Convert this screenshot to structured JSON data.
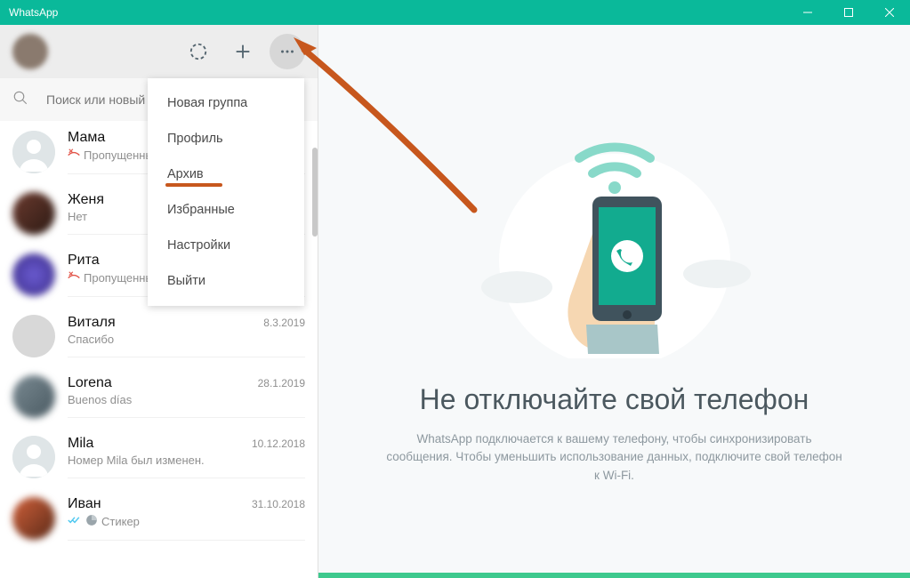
{
  "window": {
    "title": "WhatsApp"
  },
  "search": {
    "placeholder": "Поиск или новый чат"
  },
  "menu": {
    "items": [
      {
        "label": "Новая группа"
      },
      {
        "label": "Профиль"
      },
      {
        "label": "Архив",
        "highlight": true
      },
      {
        "label": "Избранные"
      },
      {
        "label": "Настройки"
      },
      {
        "label": "Выйти"
      }
    ]
  },
  "chats": [
    {
      "name": "Мама",
      "date": "",
      "preview": "Пропущенный звонок",
      "missed": true,
      "avatar": "person"
    },
    {
      "name": "Женя",
      "date": "",
      "preview": "Нет",
      "avatar": "blur1"
    },
    {
      "name": "Рита",
      "date": "",
      "preview": "Пропущенный звонок",
      "missed": true,
      "avatar": "blur2"
    },
    {
      "name": "Виталя",
      "date": "8.3.2019",
      "preview": "Спасибо",
      "avatar": "none"
    },
    {
      "name": "Lorena",
      "date": "28.1.2019",
      "preview": "Buenos días",
      "avatar": "blur3"
    },
    {
      "name": "Mila",
      "date": "10.12.2018",
      "preview": "Номер Mila был изменен.",
      "avatar": "person"
    },
    {
      "name": "Иван",
      "date": "31.10.2018",
      "preview": "Стикер",
      "ticks": true,
      "sticker": true,
      "avatar": "blur4"
    }
  ],
  "landing": {
    "heading": "Не отключайте свой телефон",
    "text": "WhatsApp подключается к вашему телефону, чтобы синхронизировать сообщения. Чтобы уменьшить использование данных, подключите свой телефон к Wi-Fi."
  }
}
